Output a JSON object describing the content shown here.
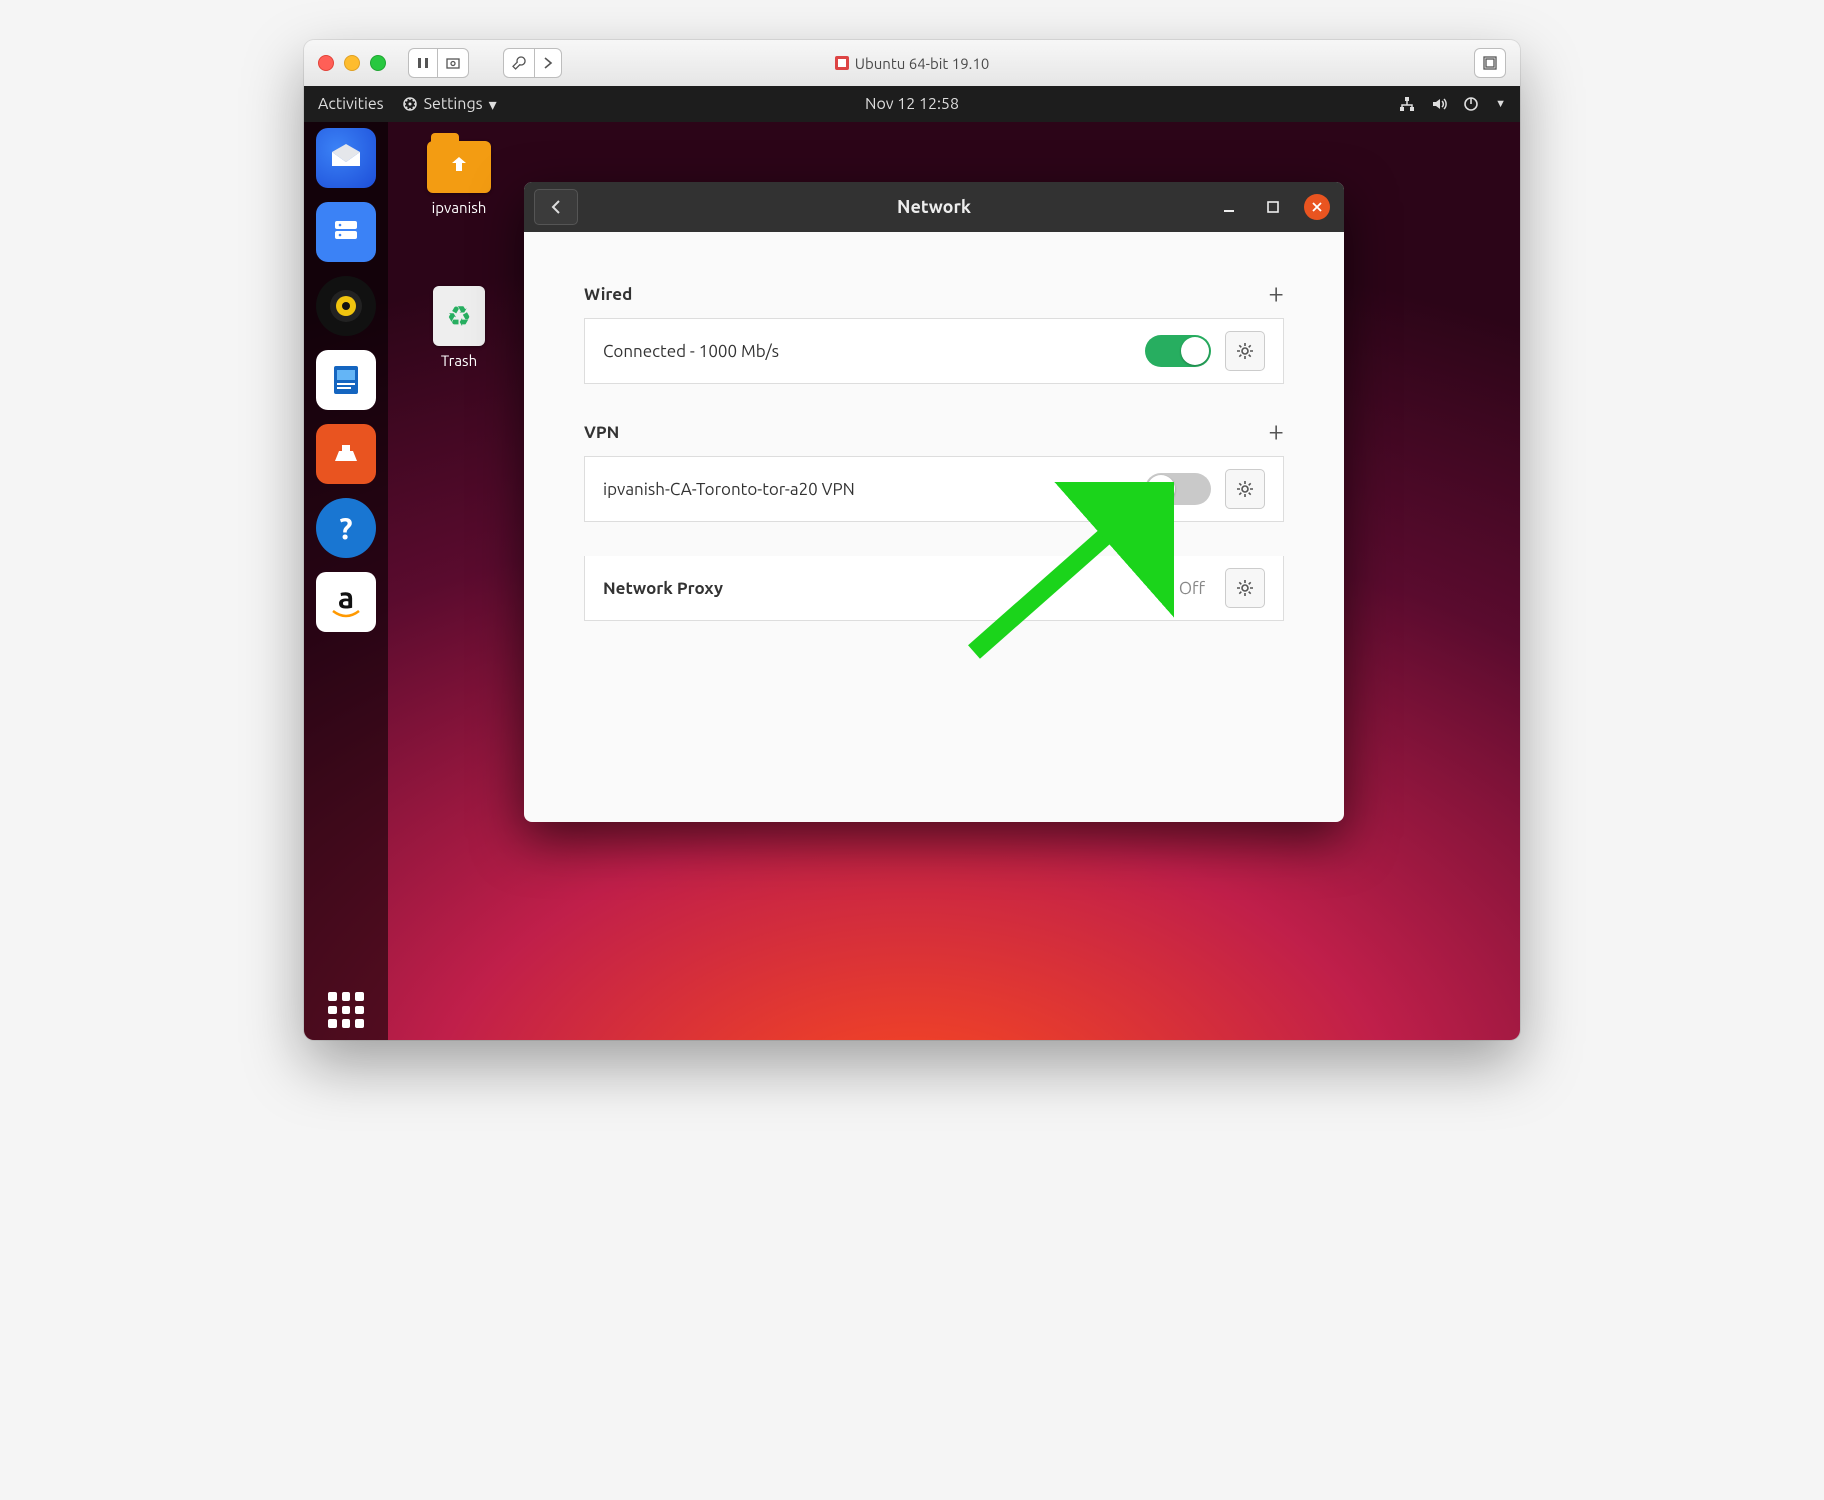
{
  "mac": {
    "title": "Ubuntu 64-bit 19.10"
  },
  "topbar": {
    "activities": "Activities",
    "app": "Settings",
    "datetime": "Nov 12  12:58"
  },
  "desktop": {
    "folder_label": "ipvanish",
    "trash_label": "Trash"
  },
  "dialog": {
    "title": "Network",
    "sections": {
      "wired": {
        "heading": "Wired",
        "row_label": "Connected - 1000 Mb/s"
      },
      "vpn": {
        "heading": "VPN",
        "row_label": "ipvanish-CA-Toronto-tor-a20 VPN"
      },
      "proxy": {
        "row_label": "Network Proxy",
        "status": "Off"
      }
    }
  }
}
